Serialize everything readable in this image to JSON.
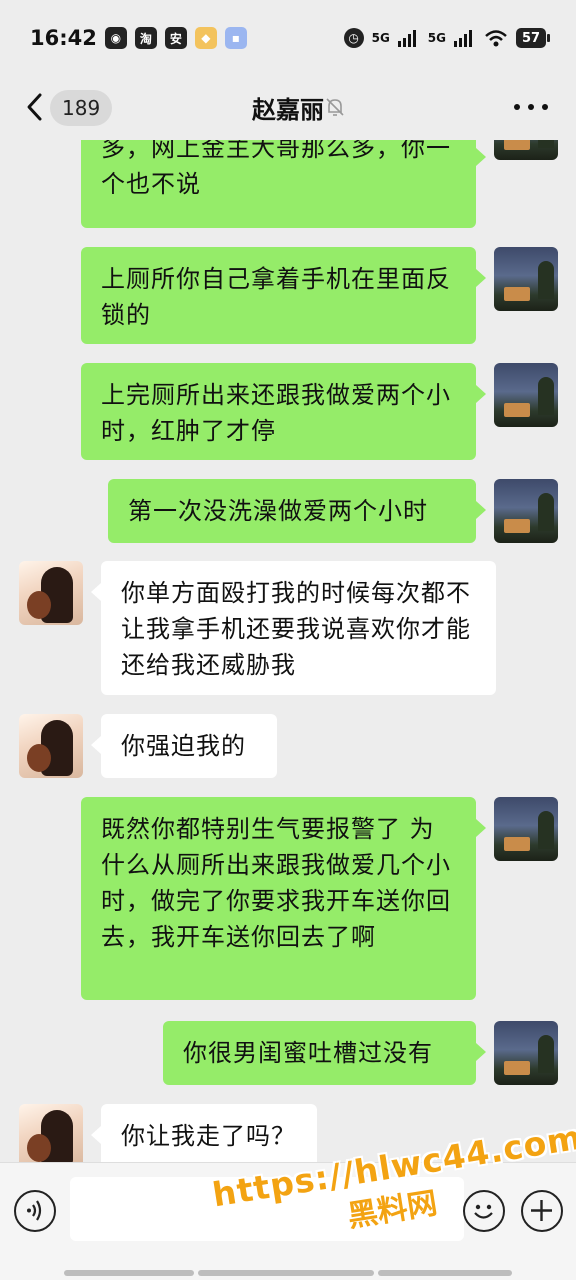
{
  "status_bar": {
    "time": "16:42",
    "left_icons": [
      "whatsapp-like-icon",
      "taobao-icon",
      "app-icon-an",
      "app-icon-yellow",
      "app-icon-blue"
    ],
    "signal1": "5G",
    "signal2": "5G",
    "battery": "57"
  },
  "header": {
    "unread_count": "189",
    "title": "赵嘉丽",
    "muted": true
  },
  "messages": [
    {
      "side": "right",
      "text": "多，网上金主大哥那么多，你一个也不说"
    },
    {
      "side": "right",
      "text": "上厕所你自己拿着手机在里面反锁的"
    },
    {
      "side": "right",
      "text": "上完厕所出来还跟我做爱两个小时，红肿了才停"
    },
    {
      "side": "right",
      "text": "第一次没洗澡做爱两个小时"
    },
    {
      "side": "left",
      "text": "你单方面殴打我的时候每次都不让我拿手机还要我说喜欢你才能还给我还威胁我"
    },
    {
      "side": "left",
      "text": "你强迫我的"
    },
    {
      "side": "right",
      "text": "既然你都特别生气要报警了 为什么从厕所出来跟我做爱几个小时，做完了你要求我开车送你回去，我开车送你回去了啊"
    },
    {
      "side": "right",
      "text": "你很男闺蜜吐槽过没有"
    },
    {
      "side": "left",
      "text": "你让我走了吗？"
    }
  ],
  "input": {
    "value": "",
    "placeholder": ""
  },
  "watermark": {
    "url": "https://hlwc44.com",
    "name": "黑料网"
  },
  "colors": {
    "background": "#ededed",
    "my_bubble": "#95ec69",
    "their_bubble": "#ffffff",
    "watermark": "#f3a312"
  }
}
